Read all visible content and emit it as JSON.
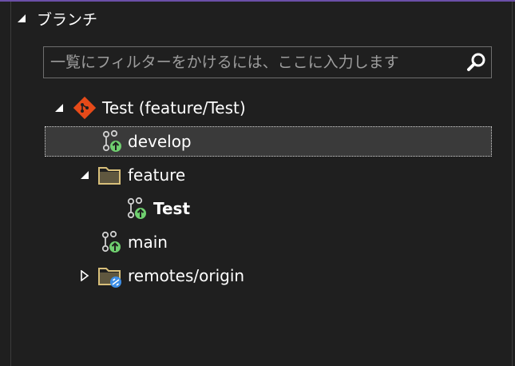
{
  "panel": {
    "title": "ブランチ"
  },
  "search": {
    "placeholder": "一覧にフィルターをかけるには、ここに入力します"
  },
  "tree": {
    "repo_label": "Test (feature/Test)",
    "develop_label": "develop",
    "feature_label": "feature",
    "feature_test_label": "Test",
    "main_label": "main",
    "remotes_label": "remotes/origin"
  },
  "icons": {
    "repo": "git-repo-icon",
    "branch": "branch-icon",
    "folder": "folder-icon",
    "remote_folder": "remote-folder-icon",
    "search": "search-icon"
  },
  "colors": {
    "background": "#1f1f1f",
    "accent": "#6b4fa8",
    "selected_row": "#3a3a3a",
    "git_red": "#e64a19",
    "branch_green": "#6fcf6f",
    "folder_yellow": "#d8bf7a",
    "remote_blue": "#3d8ee6"
  }
}
